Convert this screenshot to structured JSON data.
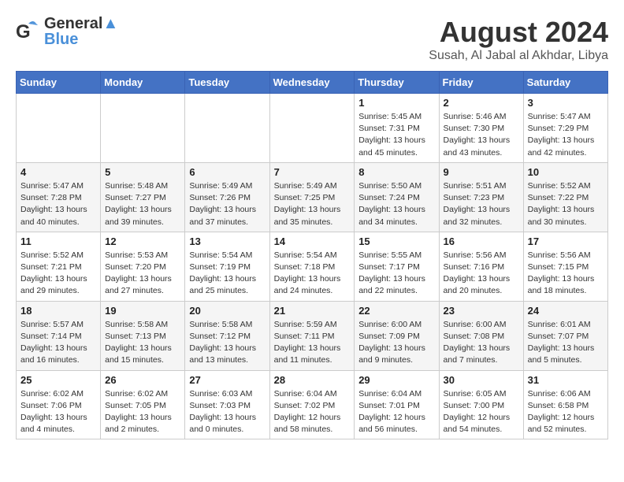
{
  "header": {
    "logo_line1": "General",
    "logo_line2": "Blue",
    "month": "August 2024",
    "location": "Susah, Al Jabal al Akhdar, Libya"
  },
  "days_of_week": [
    "Sunday",
    "Monday",
    "Tuesday",
    "Wednesday",
    "Thursday",
    "Friday",
    "Saturday"
  ],
  "weeks": [
    [
      {
        "day": "",
        "info": ""
      },
      {
        "day": "",
        "info": ""
      },
      {
        "day": "",
        "info": ""
      },
      {
        "day": "",
        "info": ""
      },
      {
        "day": "1",
        "info": "Sunrise: 5:45 AM\nSunset: 7:31 PM\nDaylight: 13 hours\nand 45 minutes."
      },
      {
        "day": "2",
        "info": "Sunrise: 5:46 AM\nSunset: 7:30 PM\nDaylight: 13 hours\nand 43 minutes."
      },
      {
        "day": "3",
        "info": "Sunrise: 5:47 AM\nSunset: 7:29 PM\nDaylight: 13 hours\nand 42 minutes."
      }
    ],
    [
      {
        "day": "4",
        "info": "Sunrise: 5:47 AM\nSunset: 7:28 PM\nDaylight: 13 hours\nand 40 minutes."
      },
      {
        "day": "5",
        "info": "Sunrise: 5:48 AM\nSunset: 7:27 PM\nDaylight: 13 hours\nand 39 minutes."
      },
      {
        "day": "6",
        "info": "Sunrise: 5:49 AM\nSunset: 7:26 PM\nDaylight: 13 hours\nand 37 minutes."
      },
      {
        "day": "7",
        "info": "Sunrise: 5:49 AM\nSunset: 7:25 PM\nDaylight: 13 hours\nand 35 minutes."
      },
      {
        "day": "8",
        "info": "Sunrise: 5:50 AM\nSunset: 7:24 PM\nDaylight: 13 hours\nand 34 minutes."
      },
      {
        "day": "9",
        "info": "Sunrise: 5:51 AM\nSunset: 7:23 PM\nDaylight: 13 hours\nand 32 minutes."
      },
      {
        "day": "10",
        "info": "Sunrise: 5:52 AM\nSunset: 7:22 PM\nDaylight: 13 hours\nand 30 minutes."
      }
    ],
    [
      {
        "day": "11",
        "info": "Sunrise: 5:52 AM\nSunset: 7:21 PM\nDaylight: 13 hours\nand 29 minutes."
      },
      {
        "day": "12",
        "info": "Sunrise: 5:53 AM\nSunset: 7:20 PM\nDaylight: 13 hours\nand 27 minutes."
      },
      {
        "day": "13",
        "info": "Sunrise: 5:54 AM\nSunset: 7:19 PM\nDaylight: 13 hours\nand 25 minutes."
      },
      {
        "day": "14",
        "info": "Sunrise: 5:54 AM\nSunset: 7:18 PM\nDaylight: 13 hours\nand 24 minutes."
      },
      {
        "day": "15",
        "info": "Sunrise: 5:55 AM\nSunset: 7:17 PM\nDaylight: 13 hours\nand 22 minutes."
      },
      {
        "day": "16",
        "info": "Sunrise: 5:56 AM\nSunset: 7:16 PM\nDaylight: 13 hours\nand 20 minutes."
      },
      {
        "day": "17",
        "info": "Sunrise: 5:56 AM\nSunset: 7:15 PM\nDaylight: 13 hours\nand 18 minutes."
      }
    ],
    [
      {
        "day": "18",
        "info": "Sunrise: 5:57 AM\nSunset: 7:14 PM\nDaylight: 13 hours\nand 16 minutes."
      },
      {
        "day": "19",
        "info": "Sunrise: 5:58 AM\nSunset: 7:13 PM\nDaylight: 13 hours\nand 15 minutes."
      },
      {
        "day": "20",
        "info": "Sunrise: 5:58 AM\nSunset: 7:12 PM\nDaylight: 13 hours\nand 13 minutes."
      },
      {
        "day": "21",
        "info": "Sunrise: 5:59 AM\nSunset: 7:11 PM\nDaylight: 13 hours\nand 11 minutes."
      },
      {
        "day": "22",
        "info": "Sunrise: 6:00 AM\nSunset: 7:09 PM\nDaylight: 13 hours\nand 9 minutes."
      },
      {
        "day": "23",
        "info": "Sunrise: 6:00 AM\nSunset: 7:08 PM\nDaylight: 13 hours\nand 7 minutes."
      },
      {
        "day": "24",
        "info": "Sunrise: 6:01 AM\nSunset: 7:07 PM\nDaylight: 13 hours\nand 5 minutes."
      }
    ],
    [
      {
        "day": "25",
        "info": "Sunrise: 6:02 AM\nSunset: 7:06 PM\nDaylight: 13 hours\nand 4 minutes."
      },
      {
        "day": "26",
        "info": "Sunrise: 6:02 AM\nSunset: 7:05 PM\nDaylight: 13 hours\nand 2 minutes."
      },
      {
        "day": "27",
        "info": "Sunrise: 6:03 AM\nSunset: 7:03 PM\nDaylight: 13 hours\nand 0 minutes."
      },
      {
        "day": "28",
        "info": "Sunrise: 6:04 AM\nSunset: 7:02 PM\nDaylight: 12 hours\nand 58 minutes."
      },
      {
        "day": "29",
        "info": "Sunrise: 6:04 AM\nSunset: 7:01 PM\nDaylight: 12 hours\nand 56 minutes."
      },
      {
        "day": "30",
        "info": "Sunrise: 6:05 AM\nSunset: 7:00 PM\nDaylight: 12 hours\nand 54 minutes."
      },
      {
        "day": "31",
        "info": "Sunrise: 6:06 AM\nSunset: 6:58 PM\nDaylight: 12 hours\nand 52 minutes."
      }
    ]
  ]
}
